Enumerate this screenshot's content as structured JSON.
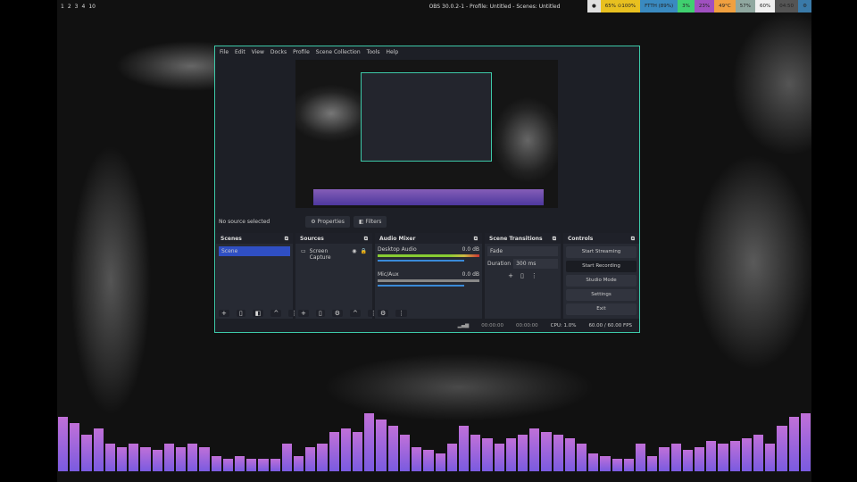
{
  "topbar": {
    "workspaces": [
      "1",
      "2",
      "3",
      "4",
      "10"
    ],
    "title": "OBS 30.0.2-1 - Profile: Untitled - Scenes: Untitled",
    "status": [
      {
        "text": "●",
        "color": "#e0e0e0"
      },
      {
        "text": "65% ⊙100%",
        "color": "#e8c020"
      },
      {
        "text": "FTTH (89%)",
        "color": "#3a8ac0"
      },
      {
        "text": "3%",
        "color": "#40d070"
      },
      {
        "text": "23%",
        "color": "#a050c0"
      },
      {
        "text": "49°C",
        "color": "#f0a040"
      },
      {
        "text": "57%",
        "color": "#90a8a0"
      },
      {
        "text": "60%",
        "color": "#f0f0f0"
      },
      {
        "text": "04:50",
        "color": "#555"
      },
      {
        "text": "⚙",
        "color": "#3a7aa8"
      }
    ]
  },
  "menu": [
    "File",
    "Edit",
    "View",
    "Docks",
    "Profile",
    "Scene Collection",
    "Tools",
    "Help"
  ],
  "info": {
    "no_source": "No source selected",
    "properties": "⚙ Properties",
    "filters": "◧ Filters"
  },
  "scenes": {
    "title": "Scenes",
    "items": [
      "Scene"
    ]
  },
  "sources": {
    "title": "Sources",
    "items": [
      "Screen Capture"
    ]
  },
  "mixer": {
    "title": "Audio Mixer",
    "channels": [
      {
        "name": "Desktop Audio",
        "db": "0.0 dB"
      },
      {
        "name": "Mic/Aux",
        "db": "0.0 dB"
      }
    ]
  },
  "transitions": {
    "title": "Scene Transitions",
    "type": "Fade",
    "duration_label": "Duration",
    "duration": "300 ms"
  },
  "controls": {
    "title": "Controls",
    "buttons": [
      "Start Streaming",
      "Start Recording",
      "Studio Mode",
      "Settings",
      "Exit"
    ]
  },
  "statusbar": {
    "stream_time": "00:00:00",
    "rec_time": "00:00:00",
    "cpu": "CPU: 1.0%",
    "fps": "60.00 / 60.00 FPS"
  },
  "visualizer_levels": [
    0.9,
    0.8,
    0.6,
    0.7,
    0.45,
    0.4,
    0.45,
    0.4,
    0.35,
    0.45,
    0.4,
    0.45,
    0.4,
    0.25,
    0.2,
    0.25,
    0.2,
    0.2,
    0.2,
    0.45,
    0.25,
    0.4,
    0.45,
    0.65,
    0.7,
    0.65,
    0.95,
    0.85,
    0.75,
    0.6,
    0.4,
    0.35,
    0.3,
    0.45,
    0.75,
    0.6,
    0.55,
    0.45,
    0.55,
    0.6,
    0.7,
    0.65,
    0.6,
    0.55,
    0.45,
    0.3,
    0.25,
    0.2,
    0.2,
    0.45,
    0.25,
    0.4,
    0.45,
    0.35,
    0.4,
    0.5,
    0.45,
    0.5,
    0.55,
    0.6,
    0.45,
    0.75,
    0.9,
    0.95
  ]
}
